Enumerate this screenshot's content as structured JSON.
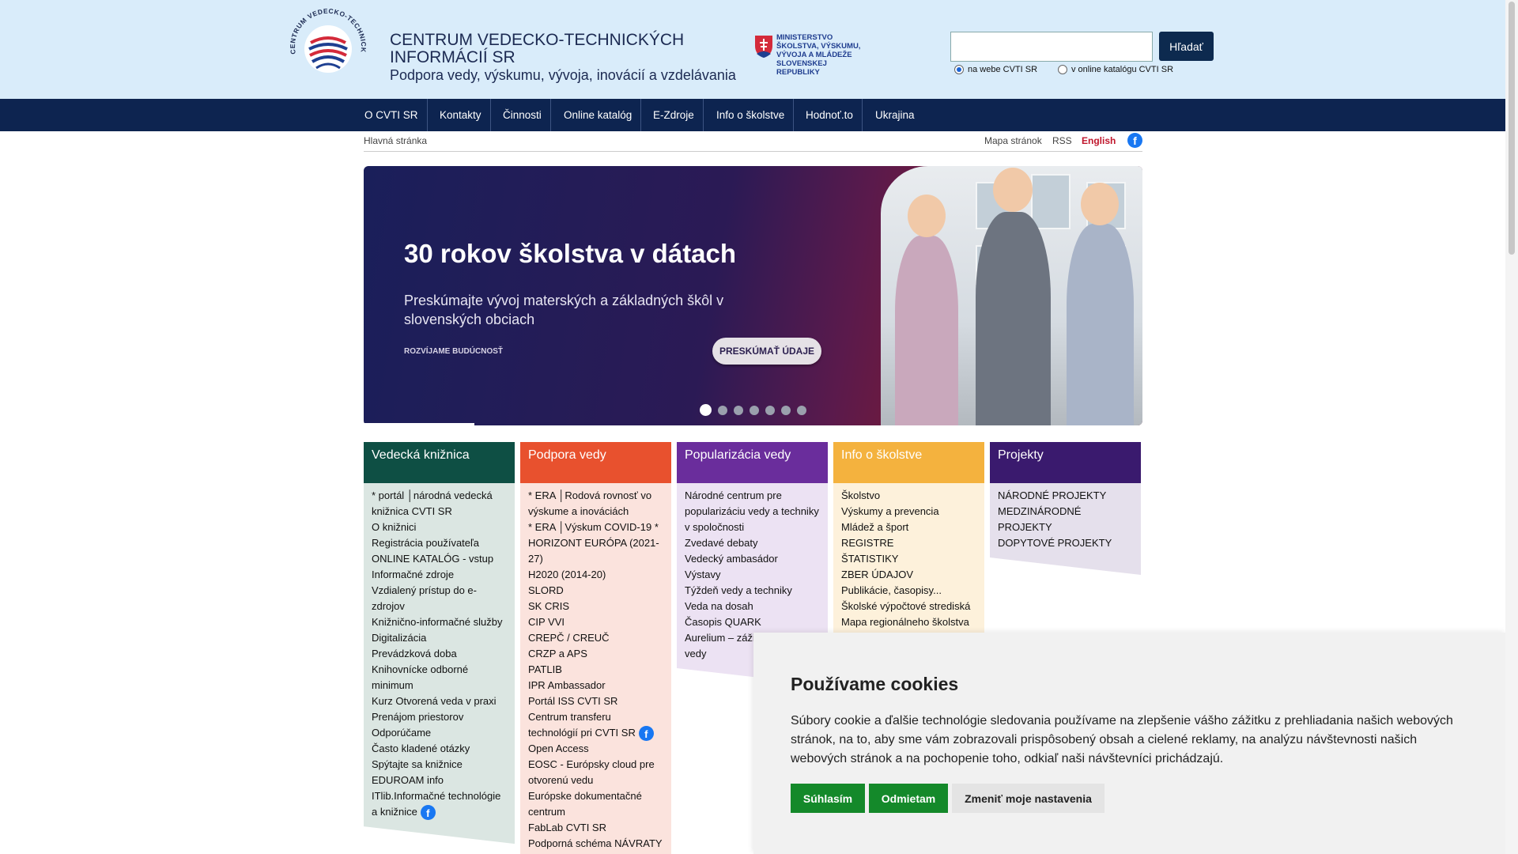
{
  "header": {
    "title_line1": "CENTRUM VEDECKO-TECHNICKÝCH",
    "title_line2": "INFORMÁCIÍ SR",
    "tagline": "Podpora vedy, výskumu, vývoja, inovácií a vzdelávania",
    "ministry_line1": "MINISTERSTVO",
    "ministry_line2": "ŠKOLSTVA, VÝSKUMU,",
    "ministry_line3": "VÝVOJA A MLÁDEŽE",
    "ministry_line4": "SLOVENSKEJ REPUBLIKY",
    "search_value": "",
    "search_button": "Hľadať",
    "radio_web": "na webe CVTI SR",
    "radio_catalog": "v online katalógu CVTI SR"
  },
  "nav": [
    "O CVTI SR",
    "Kontakty",
    "Činnosti",
    "Online katalóg",
    "E-Zdroje",
    "Info o školstve",
    "Hodnoť.to",
    "Ukrajina"
  ],
  "utility": {
    "breadcrumb": "Hlavná stránka",
    "sitemap": "Mapa stránok",
    "rss": "RSS",
    "english": "English",
    "facebook_icon": "facebook-icon"
  },
  "banner": {
    "title": "30 rokov školstva v dátach",
    "subtitle": "Preskúmajte vývoj materských a základných škôl v slovenských obciach",
    "tag": "ROZVÍJAME BUDÚCNOSŤ",
    "cta": "PRESKÚMAŤ ÚDAJE",
    "slide_count": 7,
    "active_slide": 1
  },
  "columns": [
    {
      "title": "Vedecká knižnica",
      "head_color": "#0e4f44",
      "body_color": "#dbe6e2",
      "items": [
        "* portál │národná vedecká knižnica CVTI SR",
        "O knižnici",
        "Registrácia používateľa",
        "ONLINE KATALÓG - vstup",
        "Informačné zdroje",
        "Vzdialený prístup do e-zdrojov",
        "Knižnično-informačné služby",
        "Digitalizácia",
        "Prevádzková doba",
        "Knihovnícke odborné minimum",
        "Kurz Otvorená veda v praxi",
        "Prenájom priestorov",
        "Odporúčame",
        "Často kladené otázky",
        "Spýtajte sa knižnice",
        "EDUROAM info",
        "ITlib.Informačné technológie a knižnice"
      ]
    },
    {
      "title": "Podpora vedy",
      "head_color": "#e8512e",
      "body_color": "#fbe3dd",
      "items": [
        "* ERA │Rodová rovnosť vo výskume a inováciách",
        "* ERA │Výskum COVID-19 *",
        "HORIZONT EURÓPA (2021-27)",
        "H2020 (2014-20)",
        "SLORD",
        "SK CRIS",
        "CIP VVI",
        "CREPČ / CREUČ",
        "CRZP a APS",
        "PATLIB",
        "IPR Ambassador",
        "Portál ISS CVTI SR",
        "Centrum transferu technológií pri CVTI SR",
        "Open Access",
        "EOSC - Európsky cloud pre otvorenú vedu",
        "Európske dokumentačné centrum",
        "FabLab CVTI SR",
        "Podporná schéma NÁVRATY"
      ]
    },
    {
      "title": "Popularizácia vedy",
      "head_color": "#6a2d9c",
      "body_color": "#ece2f3",
      "items": [
        "Národné centrum pre popularizáciu vedy a techniky v spoločnosti",
        "Zvedavé debaty",
        "Vedecký ambasádor",
        "Výstavy",
        "Týždeň vedy a techniky",
        "Veda na dosah",
        "Časopis QUARK",
        "Aurelium – zážitkové centrum vedy"
      ]
    },
    {
      "title": "Info o školstve",
      "head_color": "#f4b23e",
      "body_color": "#fdf1db",
      "items": [
        "Školstvo",
        "Výskumy a prevencia",
        "Mládež a šport",
        "REGISTRE",
        "ŠTATISTIKY",
        "ZBER ÚDAJOV",
        "Publikácie, časopisy...",
        "Školské výpočtové strediská",
        "Mapa regionálneho školstva"
      ]
    },
    {
      "title": "Projekty",
      "head_color": "#3a1a6e",
      "body_color": "#e5e0ec",
      "items": [
        "NÁRODNÉ PROJEKTY",
        "MEDZINÁRODNÉ PROJEKTY",
        "DOPYTOVÉ PROJEKTY"
      ]
    }
  ],
  "cookie": {
    "title": "Používame cookies",
    "text": "Súbory cookie a ďalšie technológie sledovania používame na zlepšenie vášho zážitku z prehliadania našich webových stránok, na to, aby sme vám zobrazovali prispôsobený obsah a cielené reklamy, na analýzu návštevnosti našich webových stránok a na pochopenie toho, odkiaľ naši návštevníci prichádzajú.",
    "accept": "Súhlasím",
    "reject": "Odmietam",
    "settings": "Zmeniť moje nastavenia"
  }
}
